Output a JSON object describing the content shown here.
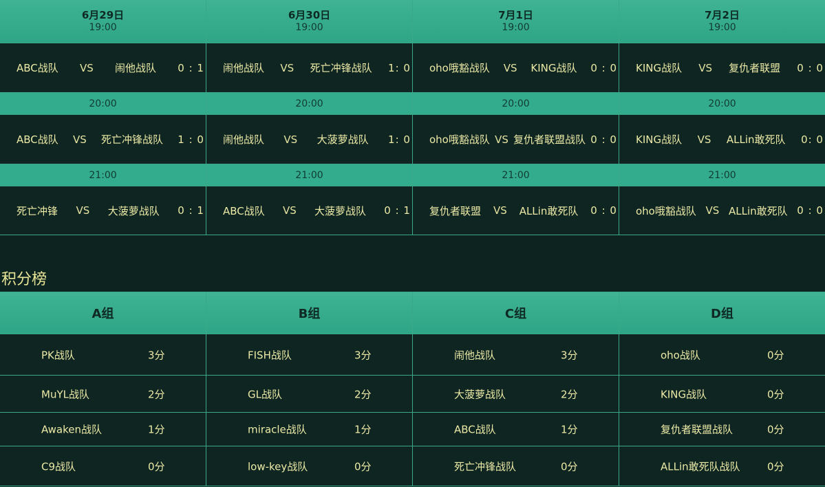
{
  "schedule": {
    "days": [
      {
        "date": "6月29日",
        "time": "19:00"
      },
      {
        "date": "6月30日",
        "time": "19:00"
      },
      {
        "date": "7月1日",
        "time": "19:00"
      },
      {
        "date": "7月2日",
        "time": "19:00"
      }
    ],
    "slots": [
      {
        "time": null,
        "matches": [
          {
            "home": "ABC战队",
            "vs": "VS",
            "away": "闹他战队",
            "score": "0 : 1"
          },
          {
            "home": "闹他战队",
            "vs": "VS",
            "away": "死亡冲锋战队",
            "score": "1: 0"
          },
          {
            "home": "oho哦豁战队",
            "vs": "VS",
            "away": "KING战队",
            "score": "0 : 0"
          },
          {
            "home": "KING战队",
            "vs": "VS",
            "away": "复仇者联盟",
            "score": "0 : 0"
          }
        ]
      },
      {
        "time": "20:00",
        "matches": [
          {
            "home": "ABC战队",
            "vs": "VS",
            "away": "死亡冲锋战队",
            "score": "1 : 0"
          },
          {
            "home": "闹他战队",
            "vs": "VS",
            "away": "大菠萝战队",
            "score": "1: 0"
          },
          {
            "home": "oho哦豁战队",
            "vs": "VS",
            "away": "复仇者联盟战队",
            "score": "0 : 0"
          },
          {
            "home": "KING战队",
            "vs": "VS",
            "away": "ALLin敢死队",
            "score": "0: 0"
          }
        ]
      },
      {
        "time": "21:00",
        "matches": [
          {
            "home": "死亡冲锋",
            "vs": "VS",
            "away": "大菠萝战队",
            "score": "0 : 1"
          },
          {
            "home": "ABC战队",
            "vs": "VS",
            "away": "大菠萝战队",
            "score": "0 : 1"
          },
          {
            "home": "复仇者联盟",
            "vs": "VS",
            "away": "ALLin敢死队",
            "score": "0 : 0"
          },
          {
            "home": "oho哦豁战队",
            "vs": "VS",
            "away": "ALLin敢死队",
            "score": "0 : 0"
          }
        ]
      }
    ]
  },
  "standings": {
    "title": "积分榜",
    "groups": [
      {
        "name": "A组",
        "rows": [
          {
            "team": "PK战队",
            "points": "3分"
          },
          {
            "team": "MuYL战队",
            "points": "2分"
          },
          {
            "team": "Awaken战队",
            "points": "1分"
          },
          {
            "team": "C9战队",
            "points": "0分"
          }
        ]
      },
      {
        "name": "B组",
        "rows": [
          {
            "team": "FISH战队",
            "points": "3分"
          },
          {
            "team": "GL战队",
            "points": "2分"
          },
          {
            "team": "miracle战队",
            "points": "1分"
          },
          {
            "team": "low-key战队",
            "points": "0分"
          }
        ]
      },
      {
        "name": "C组",
        "rows": [
          {
            "team": "闹他战队",
            "points": "3分"
          },
          {
            "team": "大菠萝战队",
            "points": "2分"
          },
          {
            "team": "ABC战队",
            "points": "1分"
          },
          {
            "team": "死亡冲锋战队",
            "points": "0分"
          }
        ]
      },
      {
        "name": "D组",
        "rows": [
          {
            "team": "oho战队",
            "points": "0分"
          },
          {
            "team": "KING战队",
            "points": "0分"
          },
          {
            "team": "复仇者联盟战队",
            "points": "0分"
          },
          {
            "team": "ALLin敢死队战队",
            "points": "0分"
          }
        ]
      }
    ]
  }
}
